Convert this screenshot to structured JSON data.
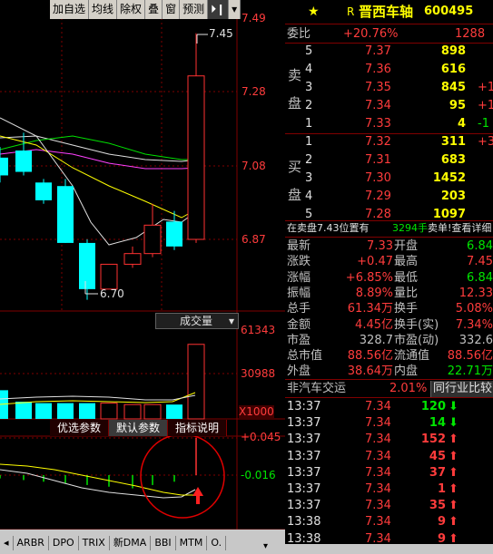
{
  "toolbar": {
    "items": [
      "加自选",
      "均线",
      "除权",
      "叠",
      "窗",
      "预测"
    ],
    "play_icon": "⏵❙",
    "menu_icon": "▾"
  },
  "chart": {
    "price_axis": [
      "7.49",
      "7.28",
      "7.08",
      "6.87"
    ],
    "high_label": "7.45",
    "low_label": "6.70",
    "volume_label": "成交量",
    "volume_axis": [
      "61343",
      "30988",
      "X1000"
    ],
    "indicator_tabs": [
      "优选参数",
      "默认参数",
      "指标说明"
    ],
    "indicator_axis": [
      "+0.045",
      "-0.016"
    ],
    "bottom_tabs": [
      "ARBR",
      "DPO",
      "TRIX",
      "新DMA",
      "BBI",
      "MTM",
      "O."
    ],
    "candles": [
      {
        "o": 7.05,
        "c": 7.1,
        "h": 7.13,
        "l": 7.03,
        "up": false
      },
      {
        "o": 7.12,
        "c": 7.06,
        "h": 7.17,
        "l": 7.05,
        "up": false
      },
      {
        "o": 7.03,
        "c": 6.98,
        "h": 7.04,
        "l": 6.97,
        "up": false
      },
      {
        "o": 7.02,
        "c": 6.86,
        "h": 7.04,
        "l": 6.86,
        "up": false
      },
      {
        "o": 6.86,
        "c": 6.73,
        "h": 6.87,
        "l": 6.7,
        "up": false
      },
      {
        "o": 6.73,
        "c": 6.8,
        "h": 6.8,
        "l": 6.73,
        "up": true
      },
      {
        "o": 6.8,
        "c": 6.83,
        "h": 6.85,
        "l": 6.79,
        "up": true
      },
      {
        "o": 6.83,
        "c": 6.91,
        "h": 6.97,
        "l": 6.82,
        "up": true
      },
      {
        "o": 6.92,
        "c": 6.85,
        "h": 6.95,
        "l": 6.84,
        "up": false
      },
      {
        "o": 6.87,
        "c": 7.33,
        "h": 7.45,
        "l": 6.86,
        "up": true
      }
    ],
    "volumes": [
      20,
      12,
      11,
      11,
      11,
      11,
      10,
      10,
      10,
      52
    ],
    "volume_up": [
      false,
      false,
      false,
      false,
      false,
      true,
      true,
      true,
      false,
      true
    ],
    "indicator_bars": [
      -0.004,
      -0.006,
      -0.008,
      -0.01,
      -0.012,
      -0.014,
      -0.016,
      -0.012,
      -0.008,
      0.045
    ]
  },
  "stock": {
    "flag": "R",
    "name": "晋西车轴",
    "code": "600495",
    "star_icon": "★"
  },
  "order_ratio": {
    "label": "委比",
    "value": "+20.76%",
    "diff": "1288"
  },
  "sell_side": {
    "label_top": "卖",
    "label_bottom": "盘",
    "rows": [
      {
        "level": "5",
        "price": "7.37",
        "vol": "898",
        "chg": ""
      },
      {
        "level": "4",
        "price": "7.36",
        "vol": "616",
        "chg": ""
      },
      {
        "level": "3",
        "price": "7.35",
        "vol": "845",
        "chg": "+1"
      },
      {
        "level": "2",
        "price": "7.34",
        "vol": "95",
        "chg": "+1"
      },
      {
        "level": "1",
        "price": "7.33",
        "vol": "4",
        "chg": "-1"
      }
    ]
  },
  "buy_side": {
    "label_top": "买",
    "label_bottom": "盘",
    "rows": [
      {
        "level": "1",
        "price": "7.32",
        "vol": "311",
        "chg": "+3"
      },
      {
        "level": "2",
        "price": "7.31",
        "vol": "683",
        "chg": ""
      },
      {
        "level": "3",
        "price": "7.30",
        "vol": "1452",
        "chg": ""
      },
      {
        "level": "4",
        "price": "7.29",
        "vol": "203",
        "chg": ""
      },
      {
        "level": "5",
        "price": "7.28",
        "vol": "1097",
        "chg": ""
      }
    ]
  },
  "pending_bar": {
    "text": "在卖盘7.43位置有",
    "vol": "3294手",
    "tail": "卖单!查看详细"
  },
  "quote": {
    "rows": [
      {
        "l1": "最新",
        "v1": "7.33",
        "l2": "开盘",
        "v2": "6.84"
      },
      {
        "l1": "涨跌",
        "v1": "+0.47",
        "l2": "最高",
        "v2": "7.45"
      },
      {
        "l1": "涨幅",
        "v1": "+6.85%",
        "l2": "最低",
        "v2": "6.84"
      },
      {
        "l1": "振幅",
        "v1": "8.89%",
        "l2": "量比",
        "v2": "12.33"
      },
      {
        "l1": "总手",
        "v1": "61.34万",
        "l2": "换手",
        "v2": "5.08%"
      },
      {
        "l1": "金额",
        "v1": "4.45亿",
        "l2": "换手(实)",
        "v2": "7.34%"
      },
      {
        "l1": "市盈",
        "v1": "328.7",
        "l2": "市盈(动)",
        "v2": "332.6"
      },
      {
        "l1": "总市值",
        "v1": "88.56亿",
        "l2": "流通值",
        "v2": "88.56亿"
      },
      {
        "l1": "外盘",
        "v1": "38.64万",
        "l2": "内盘",
        "v2": "22.71万"
      }
    ]
  },
  "sector": {
    "name": "非汽车交运",
    "pct": "2.01%",
    "compare": "同行业比较"
  },
  "ticks": [
    {
      "time": "13:37",
      "price": "7.34",
      "vol": "120",
      "dir": "down"
    },
    {
      "time": "13:37",
      "price": "7.34",
      "vol": "14",
      "dir": "down"
    },
    {
      "time": "13:37",
      "price": "7.34",
      "vol": "152",
      "dir": "up"
    },
    {
      "time": "13:37",
      "price": "7.34",
      "vol": "45",
      "dir": "up"
    },
    {
      "time": "13:37",
      "price": "7.34",
      "vol": "37",
      "dir": "up"
    },
    {
      "time": "13:37",
      "price": "7.34",
      "vol": "1",
      "dir": "up"
    },
    {
      "time": "13:37",
      "price": "7.34",
      "vol": "35",
      "dir": "up"
    },
    {
      "time": "13:38",
      "price": "7.34",
      "vol": "9",
      "dir": "up"
    },
    {
      "time": "13:38",
      "price": "7.34",
      "vol": "9",
      "dir": "up"
    }
  ]
}
